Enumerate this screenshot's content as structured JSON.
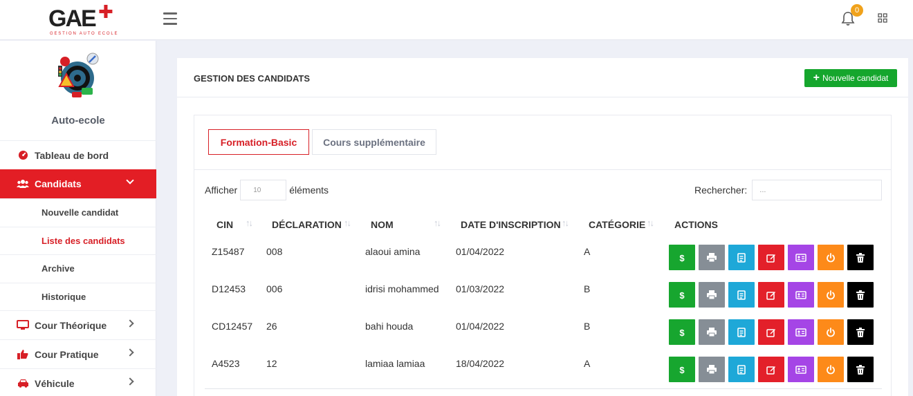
{
  "header": {
    "logo_text": "GAE",
    "logo_badge": "PLUS",
    "logo_subtitle": "GESTION AUTO ECOLE",
    "notification_count": "0"
  },
  "sidebar": {
    "brand_name": "Auto-ecole",
    "items": [
      {
        "label": "Tableau de bord"
      },
      {
        "label": "Candidats"
      },
      {
        "label": "Cour Théorique"
      },
      {
        "label": "Cour Pratique"
      },
      {
        "label": "Véhicule"
      }
    ],
    "sub_items": [
      {
        "label": "Nouvelle candidat"
      },
      {
        "label": "Liste des candidats"
      },
      {
        "label": "Archive"
      },
      {
        "label": "Historique"
      }
    ]
  },
  "card": {
    "title": "GESTION DES CANDIDATS",
    "new_button": "Nouvelle candidat",
    "tabs": [
      {
        "label": "Formation-Basic"
      },
      {
        "label": "Cours supplémentaire"
      }
    ]
  },
  "table": {
    "length_prefix": "Afficher",
    "length_value": "10",
    "length_suffix": "éléments",
    "search_label": "Rechercher:",
    "search_placeholder": "...",
    "columns": [
      "CIN",
      "DÉCLARATION",
      "NOM",
      "DATE D'INSCRIPTION",
      "CATÉGORIE",
      "ACTIONS"
    ],
    "rows": [
      {
        "cin": "Z15487",
        "declaration": "008",
        "nom": "alaoui amina",
        "date": "01/04/2022",
        "categorie": "A"
      },
      {
        "cin": "D12453",
        "declaration": "006",
        "nom": "idrisi mohammed",
        "date": "01/03/2022",
        "categorie": "B"
      },
      {
        "cin": "CD12457",
        "declaration": "26",
        "nom": "bahi houda",
        "date": "01/04/2022",
        "categorie": "B"
      },
      {
        "cin": "A4523",
        "declaration": "12",
        "nom": "lamiaa lamiaa",
        "date": "18/04/2022",
        "categorie": "A"
      }
    ],
    "action_buttons": [
      {
        "icon": "dollar-icon",
        "color": "#17a62f"
      },
      {
        "icon": "print-icon",
        "color": "#868e96"
      },
      {
        "icon": "file-icon",
        "color": "#1ea8d8"
      },
      {
        "icon": "edit-icon",
        "color": "#e3202a"
      },
      {
        "icon": "id-card-icon",
        "color": "#a545e6"
      },
      {
        "icon": "power-icon",
        "color": "#fd8a19"
      },
      {
        "icon": "trash-icon",
        "color": "#000000"
      }
    ]
  },
  "colors": {
    "primary_red": "#e31e25",
    "success_green": "#15a62d",
    "notification_orange": "#f0a21b"
  }
}
